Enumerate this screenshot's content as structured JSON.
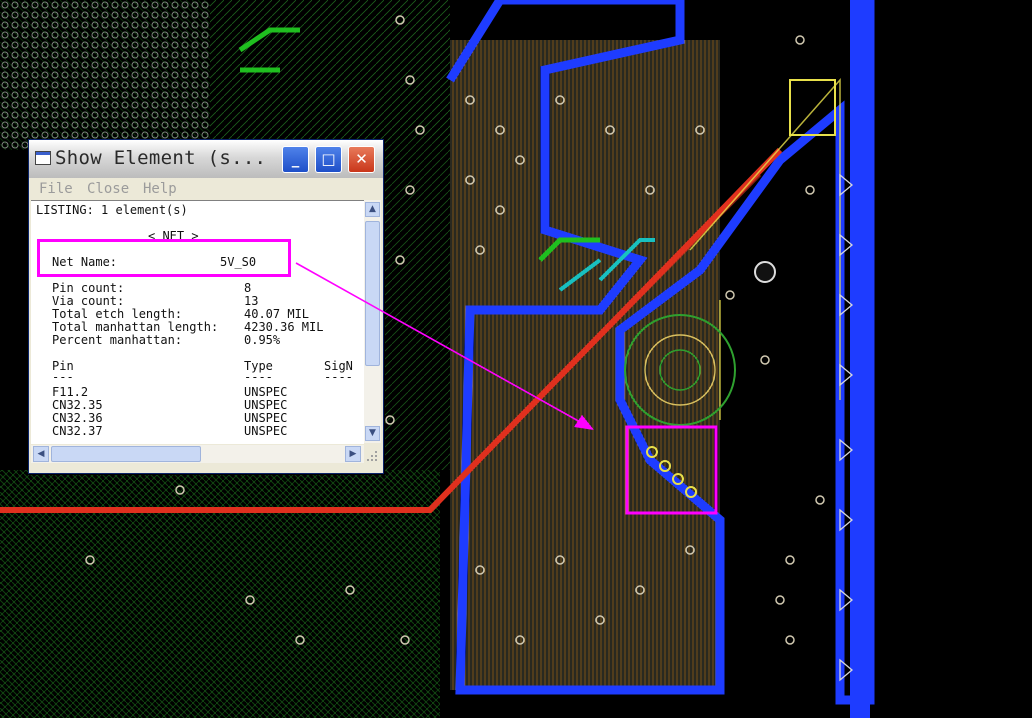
{
  "window": {
    "title": "Show Element (s...",
    "menu": [
      "File",
      "Close",
      "Help"
    ]
  },
  "listing": {
    "header": "LISTING: 1 element(s)",
    "section": "< NET >",
    "net_name_label": "Net Name:",
    "net_name_value": "5V_S0",
    "stats": [
      {
        "label": "Pin count:",
        "value": "8"
      },
      {
        "label": "Via count:",
        "value": "13"
      },
      {
        "label": "Total etch length:",
        "value": "40.07 MIL"
      },
      {
        "label": "Total manhattan length:",
        "value": "4230.36 MIL"
      },
      {
        "label": "Percent manhattan:",
        "value": "0.95%"
      }
    ],
    "columns": [
      "Pin",
      "Type",
      "SigN"
    ],
    "pins": [
      {
        "pin": "F11.2",
        "type": "UNSPEC"
      },
      {
        "pin": "CN32.35",
        "type": "UNSPEC"
      },
      {
        "pin": "CN32.36",
        "type": "UNSPEC"
      },
      {
        "pin": "CN32.37",
        "type": "UNSPEC"
      }
    ]
  },
  "colors": {
    "background": "#000000",
    "annotation": "#ff00ff",
    "plane_blue": "#1e3cff",
    "route_red": "#e0301e",
    "via_yellow": "#e8e04a",
    "trace_green": "#1fa31f",
    "trace_orange": "#d89a3a"
  }
}
